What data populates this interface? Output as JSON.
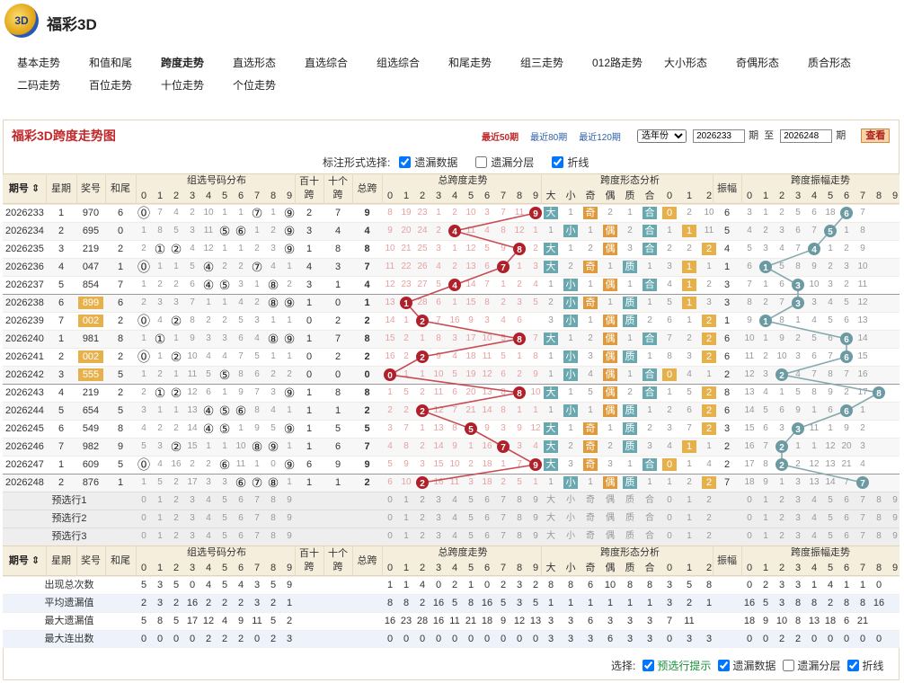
{
  "app": {
    "logo": "3D",
    "title": "福彩3D"
  },
  "nav": [
    "基本走势",
    "和值和尾",
    "跨度走势",
    "直选形态",
    "直选综合",
    "组选综合",
    "和尾走势",
    "组三走势",
    "012路走势",
    "大小形态",
    "奇偶形态",
    "质合形态",
    "二码走势",
    "百位走势",
    "十位走势",
    "个位走势"
  ],
  "nav_active": "跨度走势",
  "panel": {
    "title": "福彩3D跨度走势图",
    "links": [
      "最近50期",
      "最近80期",
      "最近120期"
    ],
    "current_link": "最近50期",
    "year_select": "选年份",
    "from": "2026233",
    "to": "2026248",
    "qi1": "期",
    "to_label": "至",
    "qi2": "期",
    "query": "查看"
  },
  "mark_options": {
    "label": "标注形式选择:",
    "items": [
      "遗漏数据",
      "遗漏分层",
      "折线"
    ],
    "checked": [
      true,
      false,
      true
    ]
  },
  "headers": {
    "period": "期号",
    "week": "星期",
    "prize": "奖号",
    "hw": "和尾",
    "group_dist": "组选号码分布",
    "bs": "百十跨",
    "sg": "十个跨",
    "total": "总跨",
    "span_trend": "总跨度走势",
    "form": "跨度形态分析",
    "form_cols": [
      "大",
      "小",
      "奇",
      "偶",
      "质",
      "合",
      "0",
      "1",
      "2"
    ],
    "amp": "振幅",
    "amp_trend": "跨度振幅走势"
  },
  "rows": [
    {
      "p": "2026233",
      "w": "1",
      "n": "970",
      "hw": "6",
      "g": [
        "⓪",
        "7",
        "4",
        "2",
        "10",
        "1",
        "1",
        "⑦",
        "1",
        "⑨"
      ],
      "bs": "2",
      "sg": "7",
      "span": "9",
      "s": [
        "8",
        "19",
        "23",
        "1",
        "2",
        "10",
        "3",
        "7",
        "11",
        "9"
      ],
      "f": [
        "大",
        "1",
        "奇",
        "2",
        "1",
        "合",
        "0",
        "2",
        "10"
      ],
      "amp": "6",
      "a": [
        "3",
        "1",
        "2",
        "5",
        "6",
        "18",
        "6",
        "7",
        "",
        ""
      ]
    },
    {
      "p": "2026234",
      "w": "2",
      "n": "695",
      "hw": "0",
      "g": [
        "1",
        "8",
        "5",
        "3",
        "11",
        "⑤",
        "⑥",
        "1",
        "2",
        "⑨"
      ],
      "bs": "3",
      "sg": "4",
      "span": "4",
      "s": [
        "9",
        "20",
        "24",
        "2",
        "4",
        "11",
        "4",
        "8",
        "12",
        "1"
      ],
      "f": [
        "1",
        "小",
        "1",
        "偶",
        "2",
        "合",
        "1",
        "1",
        "11"
      ],
      "amp": "5",
      "a": [
        "4",
        "2",
        "3",
        "6",
        "7",
        "5",
        "1",
        "8",
        "",
        ""
      ]
    },
    {
      "p": "2026235",
      "w": "3",
      "n": "219",
      "hw": "2",
      "g": [
        "2",
        "①",
        "②",
        "4",
        "12",
        "1",
        "1",
        "2",
        "3",
        "⑨"
      ],
      "bs": "1",
      "sg": "8",
      "span": "8",
      "s": [
        "10",
        "21",
        "25",
        "3",
        "1",
        "12",
        "5",
        "9",
        "8",
        "2"
      ],
      "f": [
        "大",
        "1",
        "2",
        "偶",
        "3",
        "合",
        "2",
        "2",
        "2"
      ],
      "amp": "4",
      "a": [
        "5",
        "3",
        "4",
        "7",
        "4",
        "1",
        "2",
        "9",
        "",
        ""
      ]
    },
    {
      "p": "2026236",
      "w": "4",
      "n": "047",
      "hw": "1",
      "g": [
        "⓪",
        "1",
        "1",
        "5",
        "④",
        "2",
        "2",
        "⑦",
        "4",
        "1"
      ],
      "bs": "4",
      "sg": "3",
      "span": "7",
      "s": [
        "11",
        "22",
        "26",
        "4",
        "2",
        "13",
        "6",
        "7",
        "1",
        "3"
      ],
      "f": [
        "大",
        "2",
        "奇",
        "1",
        "质",
        "1",
        "3",
        "1",
        "1"
      ],
      "amp": "1",
      "a": [
        "6",
        "1",
        "5",
        "8",
        "9",
        "2",
        "3",
        "10",
        "",
        ""
      ]
    },
    {
      "p": "2026237",
      "w": "5",
      "n": "854",
      "hw": "7",
      "g": [
        "1",
        "2",
        "2",
        "6",
        "④",
        "⑤",
        "3",
        "1",
        "⑧",
        "2"
      ],
      "bs": "3",
      "sg": "1",
      "span": "4",
      "s": [
        "12",
        "23",
        "27",
        "5",
        "4",
        "14",
        "7",
        "1",
        "2",
        "4"
      ],
      "f": [
        "1",
        "小",
        "1",
        "偶",
        "1",
        "合",
        "4",
        "1",
        "2"
      ],
      "amp": "3",
      "a": [
        "7",
        "1",
        "6",
        "3",
        "10",
        "3",
        "2",
        "11",
        "",
        ""
      ]
    },
    {
      "p": "2026238",
      "w": "6",
      "n": "899",
      "hw": "6",
      "g": [
        "2",
        "3",
        "3",
        "7",
        "1",
        "1",
        "4",
        "2",
        "⑧",
        "⑨"
      ],
      "bs": "1",
      "sg": "0",
      "span": "1",
      "s": [
        "13",
        "1",
        "28",
        "6",
        "1",
        "15",
        "8",
        "2",
        "3",
        "5"
      ],
      "f": [
        "2",
        "小",
        "奇",
        "1",
        "质",
        "1",
        "5",
        "1",
        "3"
      ],
      "amp": "3",
      "a": [
        "8",
        "2",
        "7",
        "3",
        "3",
        "4",
        "5",
        "12",
        "",
        ""
      ]
    },
    {
      "p": "2026239",
      "w": "7",
      "n": "002",
      "hw": "2",
      "g": [
        "⓪",
        "4",
        "②",
        "8",
        "2",
        "2",
        "5",
        "3",
        "1",
        "1"
      ],
      "bs": "0",
      "sg": "2",
      "span": "2",
      "s": [
        "14",
        "1",
        "2",
        "7",
        "16",
        "9",
        "3",
        "4",
        "6",
        ""
      ],
      "f": [
        "3",
        "小",
        "1",
        "偶",
        "质",
        "2",
        "6",
        "1",
        "2"
      ],
      "amp": "1",
      "a": [
        "9",
        "1",
        "8",
        "1",
        "4",
        "5",
        "6",
        "13",
        "",
        ""
      ]
    },
    {
      "p": "2026240",
      "w": "1",
      "n": "981",
      "hw": "8",
      "g": [
        "1",
        "①",
        "1",
        "9",
        "3",
        "3",
        "6",
        "4",
        "⑧",
        "⑨"
      ],
      "bs": "1",
      "sg": "7",
      "span": "8",
      "s": [
        "15",
        "2",
        "1",
        "8",
        "3",
        "17",
        "10",
        "5",
        "8",
        "7"
      ],
      "f": [
        "大",
        "1",
        "2",
        "偶",
        "1",
        "合",
        "7",
        "2",
        "2"
      ],
      "amp": "6",
      "a": [
        "10",
        "1",
        "9",
        "2",
        "5",
        "6",
        "6",
        "14",
        "",
        ""
      ]
    },
    {
      "p": "2026241",
      "w": "2",
      "n": "002",
      "hw": "2",
      "g": [
        "⓪",
        "1",
        "②",
        "10",
        "4",
        "4",
        "7",
        "5",
        "1",
        "1"
      ],
      "bs": "0",
      "sg": "2",
      "span": "2",
      "s": [
        "16",
        "2",
        "2",
        "9",
        "4",
        "18",
        "11",
        "5",
        "1",
        "8"
      ],
      "f": [
        "1",
        "小",
        "3",
        "偶",
        "质",
        "1",
        "8",
        "3",
        "2"
      ],
      "amp": "6",
      "a": [
        "11",
        "2",
        "10",
        "3",
        "6",
        "7",
        "6",
        "15",
        "",
        ""
      ]
    },
    {
      "p": "2026242",
      "w": "3",
      "n": "555",
      "hw": "5",
      "g": [
        "1",
        "2",
        "1",
        "11",
        "5",
        "⑤",
        "8",
        "6",
        "2",
        "2"
      ],
      "bs": "0",
      "sg": "0",
      "span": "0",
      "s": [
        "0",
        "1",
        "1",
        "10",
        "5",
        "19",
        "12",
        "6",
        "2",
        "9"
      ],
      "f": [
        "1",
        "小",
        "4",
        "偶",
        "1",
        "合",
        "0",
        "4",
        "1"
      ],
      "amp": "2",
      "a": [
        "12",
        "3",
        "2",
        "4",
        "7",
        "8",
        "7",
        "16",
        "",
        ""
      ]
    },
    {
      "p": "2026243",
      "w": "4",
      "n": "219",
      "hw": "2",
      "g": [
        "2",
        "①",
        "②",
        "12",
        "6",
        "1",
        "9",
        "7",
        "3",
        "⑨"
      ],
      "bs": "1",
      "sg": "8",
      "span": "8",
      "s": [
        "1",
        "5",
        "2",
        "11",
        "6",
        "20",
        "13",
        "8",
        "8",
        "10"
      ],
      "f": [
        "大",
        "1",
        "5",
        "偶",
        "2",
        "合",
        "1",
        "5",
        "2"
      ],
      "amp": "8",
      "a": [
        "13",
        "4",
        "1",
        "5",
        "8",
        "9",
        "2",
        "17",
        "8",
        ""
      ]
    },
    {
      "p": "2026244",
      "w": "5",
      "n": "654",
      "hw": "5",
      "g": [
        "3",
        "1",
        "1",
        "13",
        "④",
        "⑤",
        "⑥",
        "8",
        "4",
        "1"
      ],
      "bs": "1",
      "sg": "1",
      "span": "2",
      "s": [
        "2",
        "2",
        "6",
        "12",
        "7",
        "21",
        "14",
        "8",
        "1",
        "1"
      ],
      "f": [
        "1",
        "小",
        "1",
        "偶",
        "质",
        "1",
        "2",
        "6",
        "2"
      ],
      "amp": "6",
      "a": [
        "14",
        "5",
        "6",
        "9",
        "1",
        "6",
        "18",
        "1",
        "",
        ""
      ]
    },
    {
      "p": "2026245",
      "w": "6",
      "n": "549",
      "hw": "8",
      "g": [
        "4",
        "2",
        "2",
        "14",
        "④",
        "⑤",
        "1",
        "9",
        "5",
        "⑨"
      ],
      "bs": "1",
      "sg": "5",
      "span": "5",
      "s": [
        "3",
        "7",
        "1",
        "13",
        "8",
        "5",
        "9",
        "3",
        "9",
        "12"
      ],
      "f": [
        "大",
        "1",
        "奇",
        "1",
        "质",
        "2",
        "3",
        "7",
        "2"
      ],
      "amp": "3",
      "a": [
        "15",
        "6",
        "3",
        "10",
        "11",
        "1",
        "9",
        "2",
        "",
        ""
      ]
    },
    {
      "p": "2026246",
      "w": "7",
      "n": "982",
      "hw": "9",
      "g": [
        "5",
        "3",
        "②",
        "15",
        "1",
        "1",
        "10",
        "⑧",
        "⑨",
        "1"
      ],
      "bs": "1",
      "sg": "6",
      "span": "7",
      "s": [
        "4",
        "8",
        "2",
        "14",
        "9",
        "1",
        "16",
        "7",
        "3",
        "4"
      ],
      "f": [
        "大",
        "2",
        "奇",
        "2",
        "质",
        "3",
        "4",
        "1",
        "1"
      ],
      "amp": "2",
      "a": [
        "16",
        "7",
        "2",
        "1",
        "1",
        "12",
        "20",
        "3",
        "",
        ""
      ]
    },
    {
      "p": "2026247",
      "w": "1",
      "n": "609",
      "hw": "5",
      "g": [
        "⓪",
        "4",
        "16",
        "2",
        "2",
        "⑥",
        "11",
        "1",
        "0",
        "⑨"
      ],
      "bs": "6",
      "sg": "9",
      "span": "9",
      "s": [
        "5",
        "9",
        "3",
        "15",
        "10",
        "2",
        "18",
        "1",
        "7",
        "9"
      ],
      "f": [
        "大",
        "3",
        "奇",
        "3",
        "1",
        "合",
        "2",
        "1",
        "4"
      ],
      "amp": "2",
      "a": [
        "17",
        "8",
        "2",
        "2",
        "12",
        "13",
        "21",
        "4",
        "",
        ""
      ]
    },
    {
      "p": "2026248",
      "w": "2",
      "n": "876",
      "hw": "1",
      "g": [
        "1",
        "5",
        "2",
        "17",
        "3",
        "3",
        "⑥",
        "⑦",
        "⑧",
        "1"
      ],
      "bs": "1",
      "sg": "1",
      "span": "2",
      "s": [
        "6",
        "10",
        "2",
        "16",
        "11",
        "3",
        "18",
        "2",
        "5",
        "1"
      ],
      "f": [
        "1",
        "小",
        "1",
        "偶",
        "质",
        "1",
        "1",
        "2",
        "2"
      ],
      "amp": "7",
      "a": [
        "18",
        "9",
        "1",
        "3",
        "13",
        "14",
        "7",
        "5",
        "",
        ""
      ]
    }
  ],
  "pre_rows": [
    "预选行1",
    "预选行2",
    "预选行3"
  ],
  "stats": [
    {
      "label": "出现总次数",
      "g": [
        "5",
        "3",
        "5",
        "0",
        "4",
        "5",
        "4",
        "3",
        "5",
        "9"
      ],
      "s": [
        "1",
        "1",
        "4",
        "0",
        "2",
        "1",
        "0",
        "2",
        "3",
        "2"
      ],
      "f": [
        "8",
        "8",
        "6",
        "10",
        "8",
        "8",
        "3",
        "5",
        "8"
      ],
      "a": [
        "0",
        "2",
        "3",
        "3",
        "1",
        "4",
        "1",
        "1",
        "0",
        ""
      ]
    },
    {
      "label": "平均遗漏值",
      "g": [
        "2",
        "3",
        "2",
        "16",
        "2",
        "2",
        "2",
        "3",
        "2",
        "1"
      ],
      "s": [
        "8",
        "8",
        "2",
        "16",
        "5",
        "8",
        "16",
        "5",
        "3",
        "5"
      ],
      "f": [
        "1",
        "1",
        "1",
        "1",
        "1",
        "1",
        "3",
        "2",
        "1"
      ],
      "a": [
        "16",
        "5",
        "3",
        "8",
        "8",
        "2",
        "8",
        "8",
        "16",
        ""
      ]
    },
    {
      "label": "最大遗漏值",
      "g": [
        "5",
        "8",
        "5",
        "17",
        "12",
        "4",
        "9",
        "11",
        "5",
        "2"
      ],
      "s": [
        "16",
        "23",
        "28",
        "16",
        "11",
        "21",
        "18",
        "9",
        "12",
        "13"
      ],
      "f": [
        "3",
        "3",
        "6",
        "3",
        "3",
        "3",
        "7",
        "11",
        ""
      ],
      "a": [
        "18",
        "9",
        "10",
        "8",
        "13",
        "18",
        "6",
        "21",
        "",
        ""
      ]
    },
    {
      "label": "最大连出数",
      "g": [
        "0",
        "0",
        "0",
        "0",
        "2",
        "2",
        "2",
        "0",
        "2",
        "3"
      ],
      "s": [
        "0",
        "0",
        "0",
        "0",
        "0",
        "0",
        "0",
        "0",
        "0",
        "0"
      ],
      "f": [
        "3",
        "3",
        "3",
        "6",
        "3",
        "3",
        "0",
        "3",
        "3"
      ],
      "a": [
        "0",
        "0",
        "2",
        "2",
        "0",
        "0",
        "0",
        "0",
        "0",
        ""
      ]
    }
  ],
  "footer": {
    "label": "选择:",
    "items": [
      "预选行提示",
      "遗漏数据",
      "遗漏分层",
      "折线"
    ],
    "checked": [
      true,
      true,
      false,
      true
    ]
  },
  "colors": {
    "red": "#c0282a",
    "blue_gray": "#6b9aa2",
    "orange": "#e09a3c",
    "teal": "#6aa8b0"
  }
}
